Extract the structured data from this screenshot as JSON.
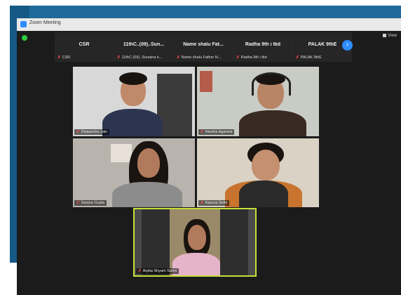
{
  "window": {
    "title": "Zoom Meeting",
    "view_label": "View"
  },
  "strip": [
    {
      "name": "CSR",
      "label": "CSR"
    },
    {
      "name": "11thC..(09)..Sun...",
      "label": "11thC.(09)..Sunaina k..."
    },
    {
      "name": "Name shalu Fat...",
      "label": "Name shalu Father N..."
    },
    {
      "name": "Radha 9th i tkd",
      "label": "Radha 9th i tkd"
    },
    {
      "name": "PALAK 9thE",
      "label": "PALAK 9thE"
    }
  ],
  "tiles": [
    {
      "label": "Dwiparshu Jain"
    },
    {
      "label": "Harsha Agarwal"
    },
    {
      "label": "Sanjna Gupta"
    },
    {
      "label": "Karuna Sethi"
    },
    {
      "label": "Arpita Shyam Sahni"
    }
  ],
  "icons": {
    "mic_muted": "✗",
    "next": "›"
  },
  "colors": {
    "accent": "#2d8cff",
    "active_speaker": "#c8e03a",
    "muted": "#ff4b4b"
  }
}
